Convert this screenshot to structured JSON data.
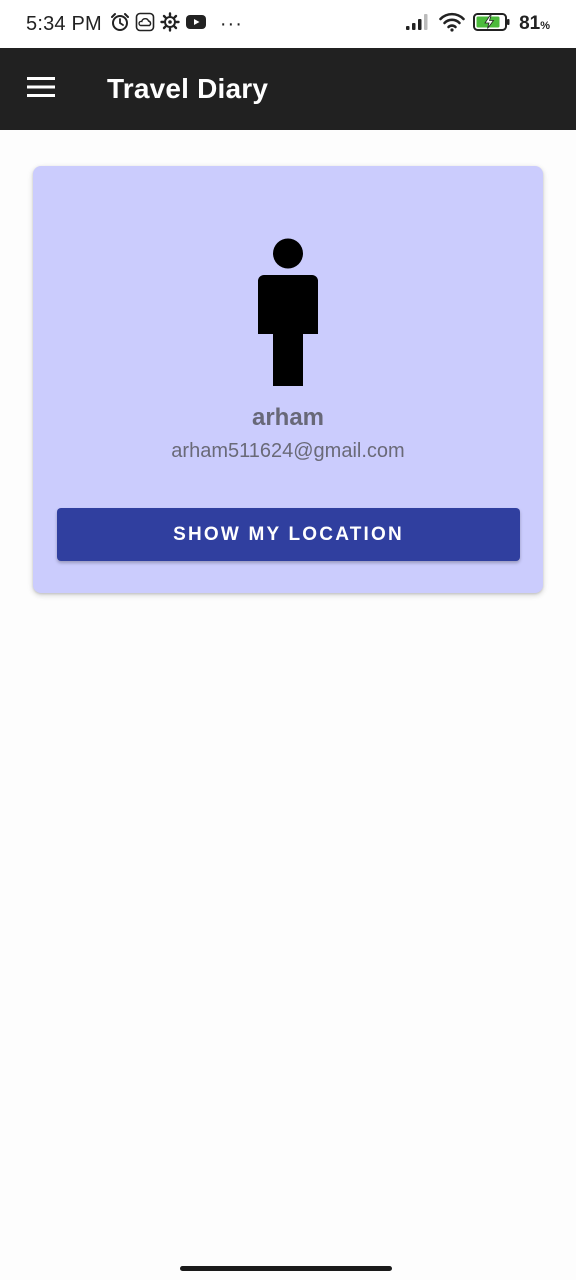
{
  "status_bar": {
    "time": "5:34 PM",
    "left_icons": [
      "alarm-icon",
      "cloud-icon",
      "settings-icon",
      "youtube-icon",
      "more-dots-icon"
    ],
    "more": "···",
    "right_icons": [
      "signal-icon",
      "wifi-icon",
      "battery-charging-icon"
    ],
    "battery_level": "81",
    "battery_unit": "%",
    "battery_fraction": 0.81
  },
  "app_bar": {
    "menu_icon": "hamburger-menu-icon",
    "title": "Travel Diary",
    "background": "#212121"
  },
  "profile": {
    "avatar_icon": "person-icon",
    "name": "arham",
    "email": "arham511624@gmail.com",
    "card_color": "#cbccfd"
  },
  "actions": {
    "show_location_label": "SHOW MY LOCATION",
    "button_color": "#303f9f"
  }
}
